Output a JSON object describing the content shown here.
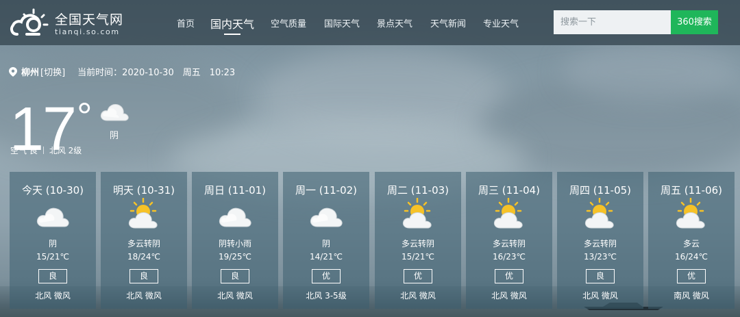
{
  "brand": {
    "title": "全国天气网",
    "subtitle": "tianqi.so.com",
    "logo_icon": "cloud-sun-logo-icon"
  },
  "nav": {
    "items": [
      "首页",
      "国内天气",
      "空气质量",
      "国际天气",
      "景点天气",
      "天气新闻",
      "专业天气"
    ],
    "active_index": 1
  },
  "search": {
    "placeholder": "搜索一下",
    "button_label": "360搜索"
  },
  "current": {
    "city": "柳州",
    "switch_label": "[切换]",
    "time_label": "当前时间：2020-10-30　周五　10:23",
    "temperature": "17",
    "degree_symbol": "°",
    "condition": "阴",
    "air_quality": "空气 良",
    "wind": "北风 2级",
    "icon": "overcast-cloud-icon"
  },
  "forecast": [
    {
      "date": "今天 (10-30)",
      "icon": "cloud-icon",
      "condition": "阴",
      "temps": "15/21℃",
      "aqi": "良",
      "wind": "北风 微风"
    },
    {
      "date": "明天 (10-31)",
      "icon": "partly-cloudy-icon",
      "condition": "多云转阴",
      "temps": "18/24℃",
      "aqi": "良",
      "wind": "北风 微风"
    },
    {
      "date": "周日 (11-01)",
      "icon": "cloud-icon",
      "condition": "阴转小雨",
      "temps": "19/25℃",
      "aqi": "良",
      "wind": "北风 微风"
    },
    {
      "date": "周一 (11-02)",
      "icon": "cloud-icon",
      "condition": "阴",
      "temps": "14/21℃",
      "aqi": "优",
      "wind": "北风 3-5级"
    },
    {
      "date": "周二 (11-03)",
      "icon": "partly-cloudy-icon",
      "condition": "多云转阴",
      "temps": "15/21℃",
      "aqi": "优",
      "wind": "北风 微风"
    },
    {
      "date": "周三 (11-04)",
      "icon": "partly-cloudy-icon",
      "condition": "多云转阴",
      "temps": "16/23℃",
      "aqi": "优",
      "wind": "北风 微风"
    },
    {
      "date": "周四 (11-05)",
      "icon": "partly-cloudy-icon",
      "condition": "多云转阴",
      "temps": "13/23℃",
      "aqi": "良",
      "wind": "北风 微风"
    },
    {
      "date": "周五 (11-06)",
      "icon": "partly-cloudy-icon",
      "condition": "多云",
      "temps": "16/24℃",
      "aqi": "优",
      "wind": "南风 微风"
    }
  ],
  "colors": {
    "header_bg": "#344550",
    "search_button": "#1fb65a",
    "card_bg": "#3c5e70",
    "sun": "#f6c227"
  }
}
